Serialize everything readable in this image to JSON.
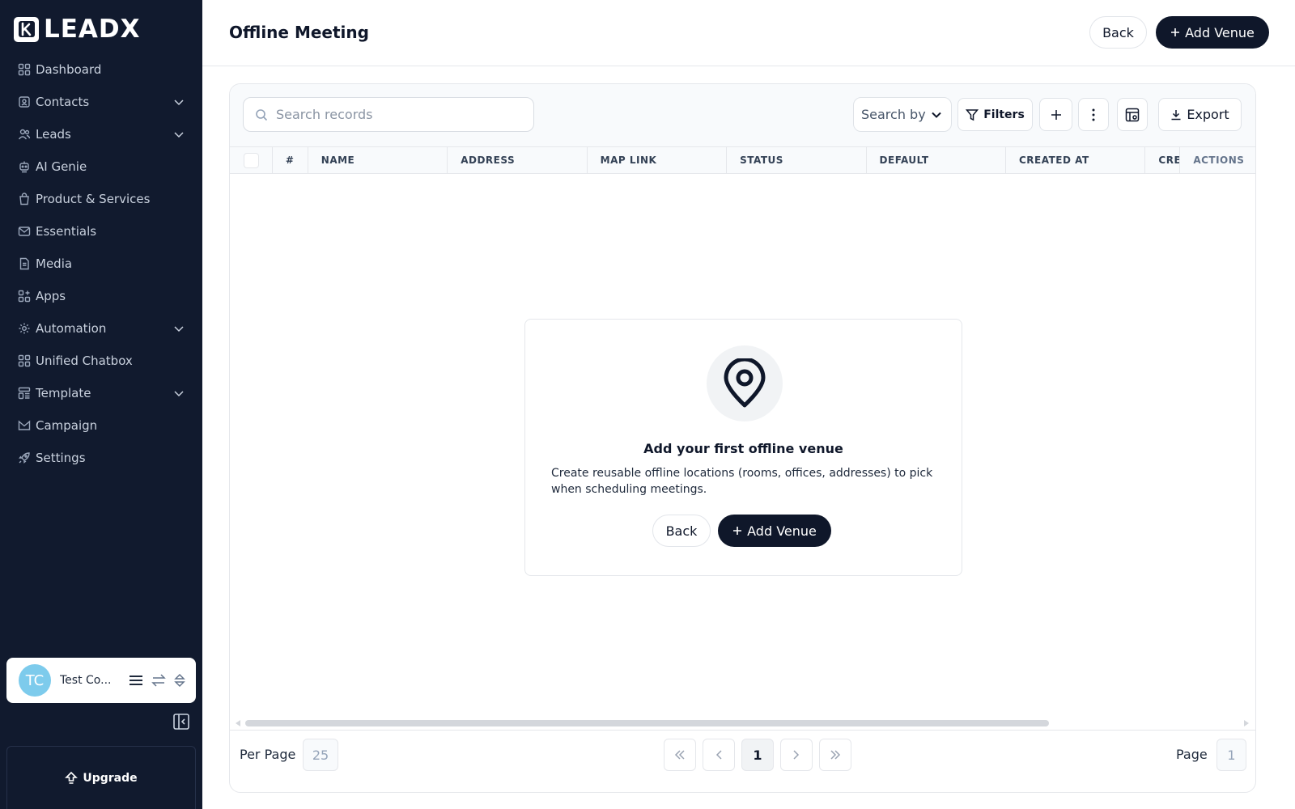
{
  "brand": {
    "name": "LEADX"
  },
  "sidebar": {
    "items": [
      {
        "label": "Dashboard",
        "icon": "dashboard-grid-icon",
        "expandable": false
      },
      {
        "label": "Contacts",
        "icon": "contacts-icon",
        "expandable": true
      },
      {
        "label": "Leads",
        "icon": "leads-icon",
        "expandable": true
      },
      {
        "label": "AI Genie",
        "icon": "ai-genie-icon",
        "expandable": false
      },
      {
        "label": "Product & Services",
        "icon": "shopping-bag-icon",
        "expandable": false
      },
      {
        "label": "Essentials",
        "icon": "mail-icon",
        "expandable": false
      },
      {
        "label": "Media",
        "icon": "file-icon",
        "expandable": false
      },
      {
        "label": "Apps",
        "icon": "apps-icon",
        "expandable": false
      },
      {
        "label": "Automation",
        "icon": "automation-gear-icon",
        "expandable": true
      },
      {
        "label": "Unified Chatbox",
        "icon": "chatbox-grid-icon",
        "expandable": false
      },
      {
        "label": "Template",
        "icon": "template-icon",
        "expandable": true
      },
      {
        "label": "Campaign",
        "icon": "campaign-mail-icon",
        "expandable": false
      },
      {
        "label": "Settings",
        "icon": "rocket-icon",
        "expandable": false
      }
    ],
    "user": {
      "initials": "TC",
      "name": "Test Co...",
      "avatar_color": "#7dcbec"
    },
    "upgrade_label": "Upgrade"
  },
  "header": {
    "title": "Offline Meeting",
    "back_label": "Back",
    "add_label": "Add Venue"
  },
  "toolbar": {
    "search_placeholder": "Search records",
    "search_by_label": "Search by",
    "filters_label": "Filters",
    "export_label": "Export"
  },
  "table": {
    "columns": [
      "#",
      "NAME",
      "ADDRESS",
      "MAP LINK",
      "STATUS",
      "DEFAULT",
      "CREATED AT",
      "CRE",
      "ACTIONS"
    ]
  },
  "empty_state": {
    "title": "Add your first offline venue",
    "description": "Create reusable offline locations (rooms, offices, addresses) to pick when scheduling meetings.",
    "back_label": "Back",
    "add_label": "Add Venue"
  },
  "pagination": {
    "per_page_label": "Per Page",
    "per_page_value": "25",
    "current_page": "1",
    "page_label": "Page",
    "page_value": "1"
  },
  "colors": {
    "sidebar_bg": "#111a2e",
    "primary": "#0f172a",
    "avatar": "#7dcbec"
  }
}
